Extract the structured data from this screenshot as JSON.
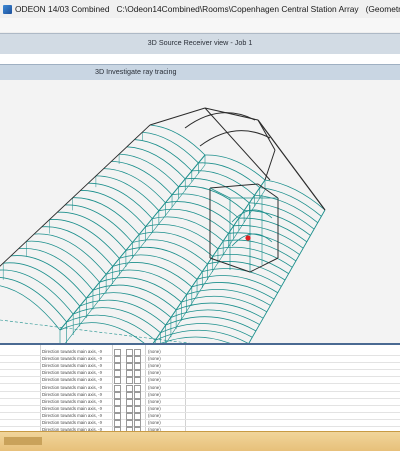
{
  "window": {
    "app_title": "ODEON 14/03 Combined",
    "path": "C:\\Odeon14Combined\\Rooms\\Copenhagen Central Station Array",
    "geometry_type": "(Geometry type: .Par)"
  },
  "windows": {
    "source_receiver_title": "3D Source Receiver view - Job 1",
    "ray_tracing_title": "3D Investigate ray tracing"
  },
  "colors": {
    "wire_teal": "#1c8f8c",
    "wire_dark": "#2b2b2b",
    "view_bg": "#f3f3f3",
    "marker_red": "#e02020"
  },
  "table": {
    "rows": [
      {
        "direction": "Direction towards main axis, -X",
        "value": "(none)"
      },
      {
        "direction": "Direction towards main axis, -X",
        "value": "(none)"
      },
      {
        "direction": "Direction towards main axis, -X",
        "value": "(none)"
      },
      {
        "direction": "Direction towards main axis, -X",
        "value": "(none)"
      },
      {
        "direction": "Direction towards main axis, -X",
        "value": "(none)"
      },
      {
        "direction": "Direction towards main axis, -X",
        "value": "(none)"
      },
      {
        "direction": "Direction towards main axis, -X",
        "value": "(none)"
      },
      {
        "direction": "Direction towards main axis, -X",
        "value": "(none)"
      },
      {
        "direction": "Direction towards main axis, -X",
        "value": "(none)"
      },
      {
        "direction": "Direction towards main axis, -X",
        "value": "(none)"
      },
      {
        "direction": "Direction towards main axis, -X",
        "value": "(none)"
      },
      {
        "direction": "Direction towards main axis, -X",
        "value": "(none)"
      }
    ]
  }
}
